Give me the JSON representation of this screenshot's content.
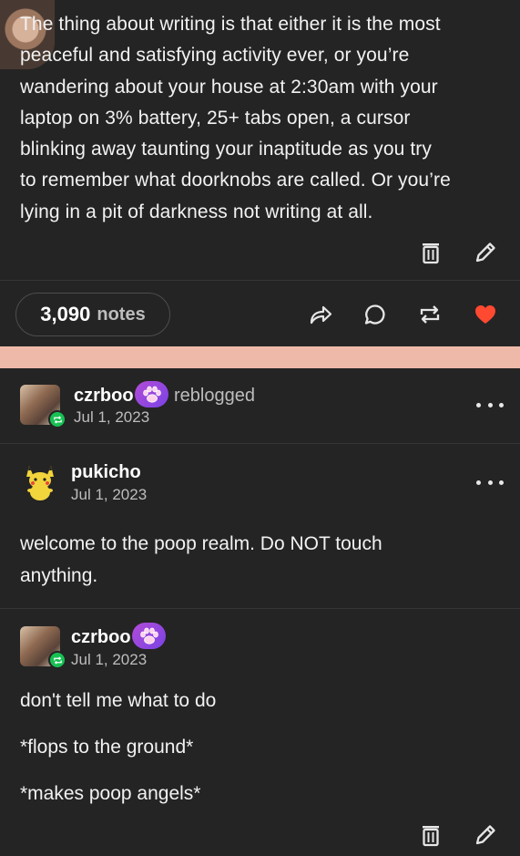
{
  "original_post": {
    "lines": [
      "The thing about writing is that either it is the most",
      "peaceful and satisfying activity ever, or you’re",
      "wandering about your house at 2:30am with your",
      "laptop on 3% battery, 25+ tabs open, a cursor",
      "blinking away taunting your inaptitude as you try",
      "to remember what doorknobs are called. Or you’re",
      "lying in a pit of darkness not writing at all."
    ]
  },
  "footer": {
    "notes_count": "3,090",
    "notes_label": "notes",
    "heart_color": "#ff4930"
  },
  "reblog_header": {
    "username": "czrboo",
    "action": "reblogged",
    "date": "Jul 1, 2023"
  },
  "thread": [
    {
      "username": "pukicho",
      "date": "Jul 1, 2023",
      "paragraphs": [
        "welcome to the poop realm. Do NOT touch",
        "anything."
      ]
    },
    {
      "username": "czrboo",
      "date": "Jul 1, 2023",
      "paragraphs": [
        "don't tell me what to do",
        "*flops to the ground*",
        "*makes poop angels*"
      ]
    }
  ],
  "icons": [
    "delete-icon",
    "edit-icon",
    "share-icon",
    "reply-icon",
    "reblog-icon",
    "heart-icon",
    "more-icon",
    "paw-icon"
  ]
}
